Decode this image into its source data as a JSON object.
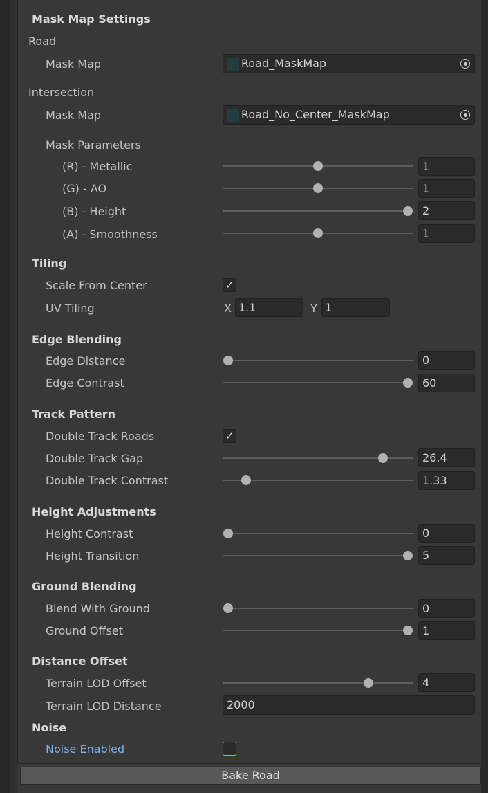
{
  "mask_map_settings": {
    "header": "Mask Map Settings",
    "road_label": "Road",
    "road_mask_label": "Mask Map",
    "road_mask_value": "Road_MaskMap",
    "intersection_label": "Intersection",
    "intersection_mask_label": "Mask Map",
    "intersection_mask_value": "Road_No_Center_MaskMap",
    "mask_params_label": "Mask Parameters",
    "params": [
      {
        "label": "(R) - Metallic",
        "value": "1",
        "fraction": 0.5
      },
      {
        "label": "(G) - AO",
        "value": "1",
        "fraction": 0.5
      },
      {
        "label": "(B) - Height",
        "value": "2",
        "fraction": 1.0
      },
      {
        "label": "(A) - Smoothness",
        "value": "1",
        "fraction": 0.5
      }
    ]
  },
  "tiling": {
    "header": "Tiling",
    "scale_from_center_label": "Scale From Center",
    "scale_from_center_checked": "✓",
    "uv_tiling_label": "UV Tiling",
    "x_label": "X",
    "x_value": "1.1",
    "y_label": "Y",
    "y_value": "1"
  },
  "edge_blending": {
    "header": "Edge Blending",
    "edge_distance_label": "Edge Distance",
    "edge_distance_value": "0",
    "edge_distance_fraction": 0.0,
    "edge_contrast_label": "Edge Contrast",
    "edge_contrast_value": "60",
    "edge_contrast_fraction": 1.0
  },
  "track_pattern": {
    "header": "Track Pattern",
    "double_track_roads_label": "Double Track Roads",
    "double_track_roads_checked": "✓",
    "double_track_gap_label": "Double Track Gap",
    "double_track_gap_value": "26.4",
    "double_track_gap_fraction": 0.86,
    "double_track_contrast_label": "Double Track Contrast",
    "double_track_contrast_value": "1.33",
    "double_track_contrast_fraction": 0.1
  },
  "height_adjustments": {
    "header": "Height Adjustments",
    "height_contrast_label": "Height Contrast",
    "height_contrast_value": "0",
    "height_contrast_fraction": 0.0,
    "height_transition_label": "Height Transition",
    "height_transition_value": "5",
    "height_transition_fraction": 1.0
  },
  "ground_blending": {
    "header": "Ground Blending",
    "blend_with_ground_label": "Blend With Ground",
    "blend_with_ground_value": "0",
    "blend_with_ground_fraction": 0.0,
    "ground_offset_label": "Ground Offset",
    "ground_offset_value": "1",
    "ground_offset_fraction": 1.0
  },
  "distance_offset": {
    "header": "Distance Offset",
    "terrain_lod_offset_label": "Terrain LOD Offset",
    "terrain_lod_offset_value": "4",
    "terrain_lod_offset_fraction": 0.78,
    "terrain_lod_distance_label": "Terrain LOD Distance",
    "terrain_lod_distance_value": "2000"
  },
  "noise": {
    "header": "Noise",
    "noise_enabled_label": "Noise Enabled"
  },
  "bake_button_label": "Bake Road",
  "colors": {
    "background": "#383838",
    "field": "#2a2a2a",
    "accent_blue": "#7fb4f2",
    "button": "#585858"
  }
}
